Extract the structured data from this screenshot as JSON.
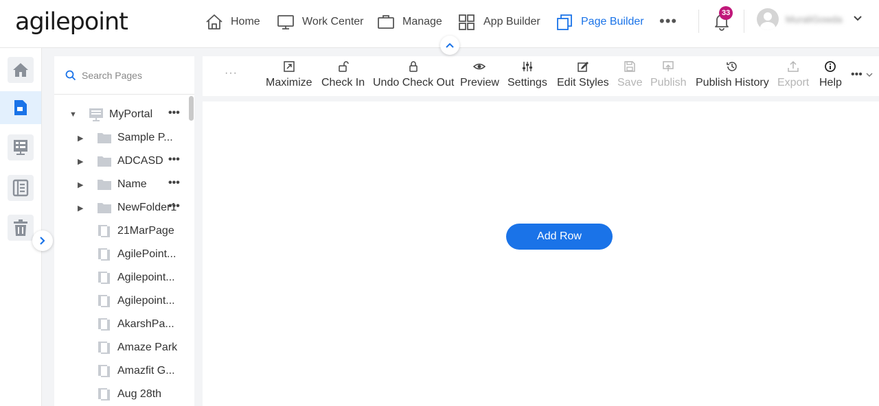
{
  "brand": {
    "logo_text": "agilepoint"
  },
  "nav": {
    "items": [
      {
        "label": "Home",
        "icon": "home-icon"
      },
      {
        "label": "Work Center",
        "icon": "monitor-icon"
      },
      {
        "label": "Manage",
        "icon": "briefcase-icon"
      },
      {
        "label": "App Builder",
        "icon": "grid-icon"
      },
      {
        "label": "Page Builder",
        "icon": "pages-icon",
        "active": true
      }
    ],
    "more_label": "•••"
  },
  "notifications": {
    "count": "33"
  },
  "user": {
    "name": "MuraliGowda"
  },
  "search": {
    "placeholder": "Search Pages"
  },
  "tree": {
    "root": {
      "label": "MyPortal"
    },
    "folders": [
      {
        "label": "Sample P..."
      },
      {
        "label": "ADCASD"
      },
      {
        "label": "Name"
      },
      {
        "label": "NewFolder1"
      }
    ],
    "pages": [
      {
        "label": "21MarPage"
      },
      {
        "label": "AgilePoint..."
      },
      {
        "label": "Agilepoint..."
      },
      {
        "label": "Agilepoint..."
      },
      {
        "label": "AkarshPa..."
      },
      {
        "label": "Amaze Park"
      },
      {
        "label": "Amazfit G..."
      },
      {
        "label": "Aug 28th"
      }
    ],
    "more_label": "•••"
  },
  "toolbar": {
    "overflow_label": "···",
    "items": [
      {
        "label": "Maximize",
        "disabled": false
      },
      {
        "label": "Check In",
        "disabled": false
      },
      {
        "label": "Undo Check Out",
        "disabled": false
      },
      {
        "label": "Preview",
        "disabled": false
      },
      {
        "label": "Settings",
        "disabled": false
      },
      {
        "label": "Edit Styles",
        "disabled": false
      },
      {
        "label": "Save",
        "disabled": true
      },
      {
        "label": "Publish",
        "disabled": true
      },
      {
        "label": "Publish History",
        "disabled": false
      },
      {
        "label": "Export",
        "disabled": true
      },
      {
        "label": "Help",
        "disabled": false
      }
    ],
    "more_label": "•••"
  },
  "canvas": {
    "add_row_label": "Add Row"
  },
  "colors": {
    "accent": "#1a73e8",
    "badge": "#c0187a",
    "disabled": "#b5b5b5"
  }
}
